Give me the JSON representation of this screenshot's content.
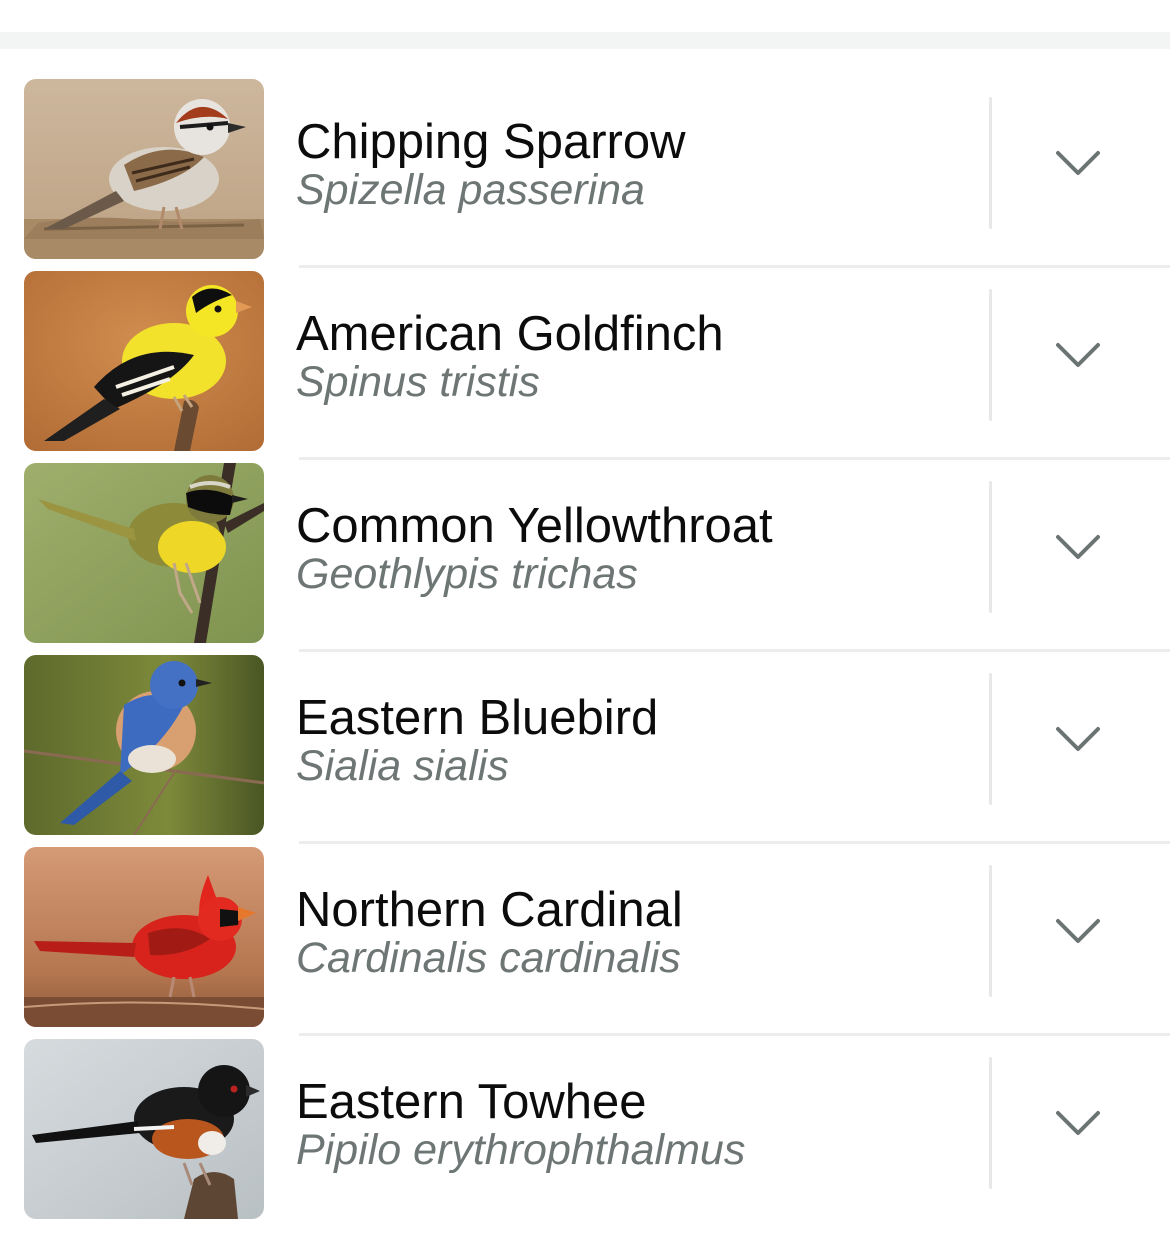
{
  "colors": {
    "common_name": "#0c0c0c",
    "scientific_name": "#6e7575",
    "chevron": "#6b7373",
    "divider": "#e6e8e8",
    "top_band": "#f3f4f4"
  },
  "species": [
    {
      "common": "Chipping Sparrow",
      "scientific": "Spizella passerina",
      "icon": "chevron-down-icon"
    },
    {
      "common": "American Goldfinch",
      "scientific": "Spinus tristis",
      "icon": "chevron-down-icon"
    },
    {
      "common": "Common Yellowthroat",
      "scientific": "Geothlypis trichas",
      "icon": "chevron-down-icon"
    },
    {
      "common": "Eastern Bluebird",
      "scientific": "Sialia sialis",
      "icon": "chevron-down-icon"
    },
    {
      "common": "Northern Cardinal",
      "scientific": "Cardinalis cardinalis",
      "icon": "chevron-down-icon"
    },
    {
      "common": "Eastern Towhee",
      "scientific": "Pipilo erythrophthalmus",
      "icon": "chevron-down-icon"
    }
  ]
}
